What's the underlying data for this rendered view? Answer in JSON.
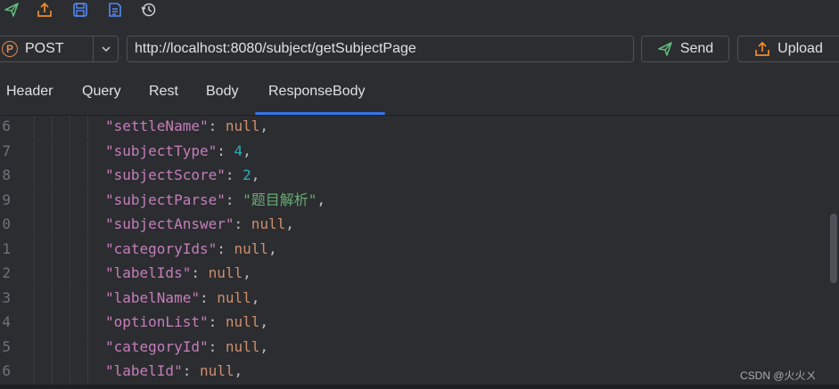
{
  "toolbar": {
    "icons": [
      "send-icon",
      "export-icon",
      "save-icon",
      "document-icon",
      "history-icon"
    ]
  },
  "request": {
    "method_badge": "P",
    "method": "POST",
    "url": "http://localhost:8080/subject/getSubjectPage",
    "send_label": "Send",
    "upload_label": "Upload"
  },
  "tabs": [
    {
      "label": "Header"
    },
    {
      "label": "Query"
    },
    {
      "label": "Rest"
    },
    {
      "label": "Body"
    },
    {
      "label": "ResponseBody",
      "active": true
    }
  ],
  "code_lines": [
    {
      "ln": "6",
      "key": "\"settleName\"",
      "val": "null",
      "type": "null"
    },
    {
      "ln": "7",
      "key": "\"subjectType\"",
      "val": "4",
      "type": "num"
    },
    {
      "ln": "8",
      "key": "\"subjectScore\"",
      "val": "2",
      "type": "num"
    },
    {
      "ln": "9",
      "key": "\"subjectParse\"",
      "val": "\"题目解析\"",
      "type": "str"
    },
    {
      "ln": "0",
      "key": "\"subjectAnswer\"",
      "val": "null",
      "type": "null"
    },
    {
      "ln": "1",
      "key": "\"categoryIds\"",
      "val": "null",
      "type": "null"
    },
    {
      "ln": "2",
      "key": "\"labelIds\"",
      "val": "null",
      "type": "null"
    },
    {
      "ln": "3",
      "key": "\"labelName\"",
      "val": "null",
      "type": "null"
    },
    {
      "ln": "4",
      "key": "\"optionList\"",
      "val": "null",
      "type": "null"
    },
    {
      "ln": "5",
      "key": "\"categoryId\"",
      "val": "null",
      "type": "null"
    },
    {
      "ln": "6",
      "key": "\"labelId\"",
      "val": "null",
      "type": "null"
    }
  ],
  "watermark": "CSDN @火火ㄨ",
  "colors": {
    "background": "#2b2d30",
    "accent": "#3574f0",
    "key": "#c77dbb",
    "null": "#cf8e6d",
    "number": "#2aacb8",
    "string": "#6aab73",
    "method": "#e08855",
    "upload_icon": "#f08c2a",
    "send_icon": "#5fb87a"
  }
}
